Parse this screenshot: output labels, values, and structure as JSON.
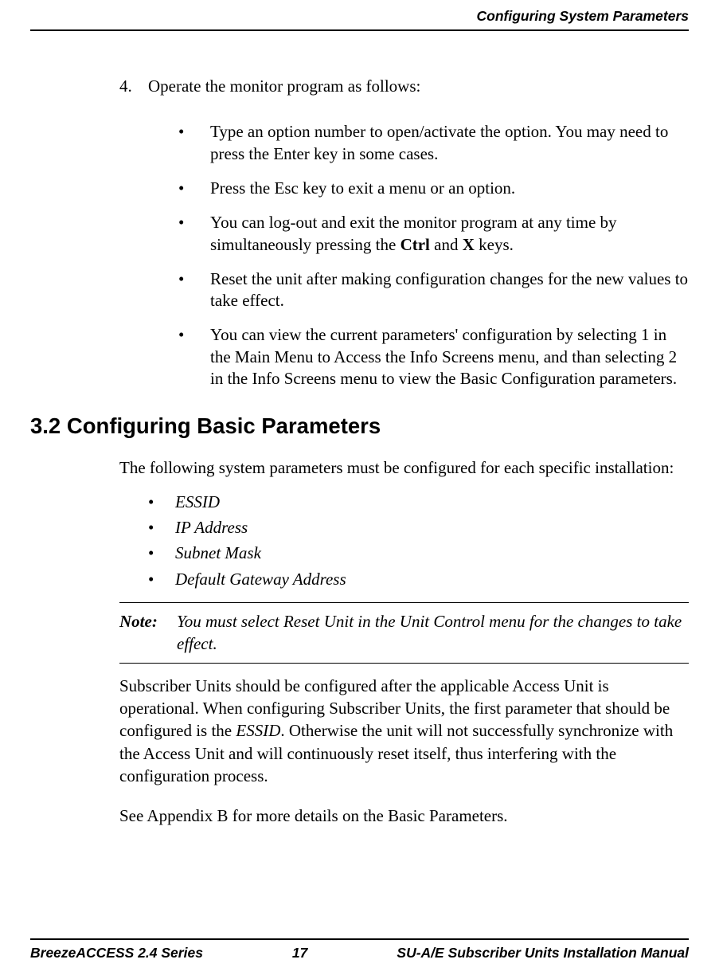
{
  "header": {
    "title": "Configuring System Parameters"
  },
  "step4": {
    "number": "4.",
    "text": "Operate the monitor program as follows:",
    "bullets": [
      "Type an option number to open/activate the option. You may need to press the Enter key in some cases.",
      "Press the Esc key to exit a menu or an option.",
      "__HTML__You can log-out and exit the monitor program at any time by simultaneously pressing the <b>Ctrl</b> and <b>X</b> keys.",
      "Reset the unit after making configuration changes for the new values to take effect.",
      "You can view the current parameters' configuration by selecting 1 in the Main Menu to Access the Info Screens menu, and than selecting 2 in the Info Screens menu to view the Basic Configuration parameters."
    ]
  },
  "section": {
    "heading": "3.2  Configuring Basic Parameters",
    "intro": "The following system parameters must be configured for each specific installation:",
    "params": [
      "ESSID",
      "IP Address",
      "Subnet Mask",
      "Default Gateway Address"
    ],
    "note_label": "Note:",
    "note_text": "You must select Reset Unit in the Unit Control menu for the changes to take effect.",
    "body1": "__HTML__Subscriber Units should be configured after the applicable Access Unit is operational. When configuring Subscriber Units, the first parameter that should be configured is the <i class=\"emb\">ESSID</i>. Otherwise the unit will not successfully synchronize with the Access Unit and will continuously reset itself, thus interfering with the configuration process.",
    "body2": "See Appendix B for more details on the Basic Parameters."
  },
  "footer": {
    "left": "BreezeACCESS 2.4 Series",
    "center": "17",
    "right": "SU-A/E Subscriber Units Installation Manual"
  }
}
